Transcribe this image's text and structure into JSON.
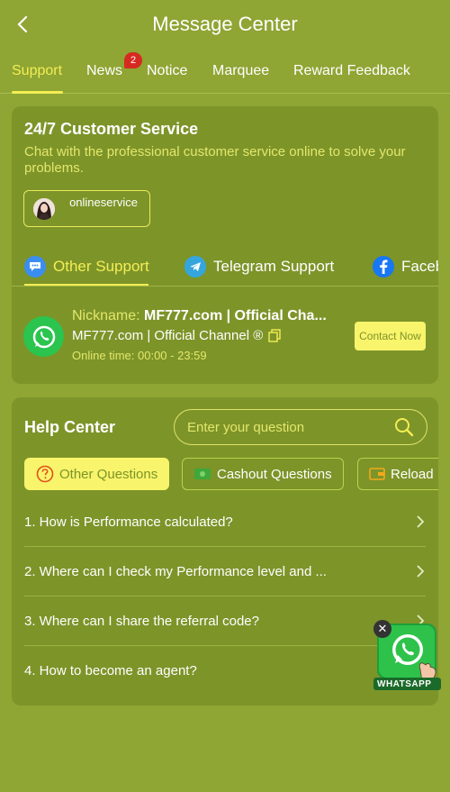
{
  "header": {
    "title": "Message Center"
  },
  "tabs": [
    {
      "label": "Support",
      "active": true
    },
    {
      "label": "News",
      "badge": "2"
    },
    {
      "label": "Notice"
    },
    {
      "label": "Marquee"
    },
    {
      "label": "Reward Feedback"
    }
  ],
  "customer_service": {
    "title": "24/7 Customer Service",
    "description": "Chat with the professional customer service online to solve your problems.",
    "online_button": "onlineservice",
    "subtabs": [
      {
        "label": "Other Support",
        "icon": "chat-bubble-icon",
        "active": true
      },
      {
        "label": "Telegram Support",
        "icon": "telegram-icon"
      },
      {
        "label": "Facebook",
        "icon": "facebook-icon"
      }
    ],
    "contact": {
      "nickname_label": "Nickname:",
      "nickname_value": "MF777.com | Official Cha...",
      "channel": "MF777.com | Official Channel ®",
      "online_time_label": "Online time:",
      "online_time_value": "00:00 - 23:59",
      "button": "Contact Now"
    }
  },
  "help_center": {
    "title": "Help Center",
    "search_placeholder": "Enter your question",
    "tabs": [
      {
        "label": "Other Questions",
        "icon": "question-circle-icon",
        "active": true
      },
      {
        "label": "Cashout Questions",
        "icon": "cash-icon"
      },
      {
        "label": "Reload",
        "icon": "wallet-icon"
      }
    ],
    "questions": [
      "1. How is Performance calculated?",
      "2. Where can I check my Performance level and ...",
      "3. Where can I share the referral code?",
      "4. How to become an agent?"
    ]
  },
  "whatsapp_float": {
    "label": "WHATSAPP"
  },
  "colors": {
    "background": "#8fa534",
    "card": "#7d9429",
    "accent_yellow": "#f3ee54",
    "text_yellow": "#e3e76b",
    "badge_red": "#d62a21",
    "whatsapp_green": "#2bc44f"
  }
}
